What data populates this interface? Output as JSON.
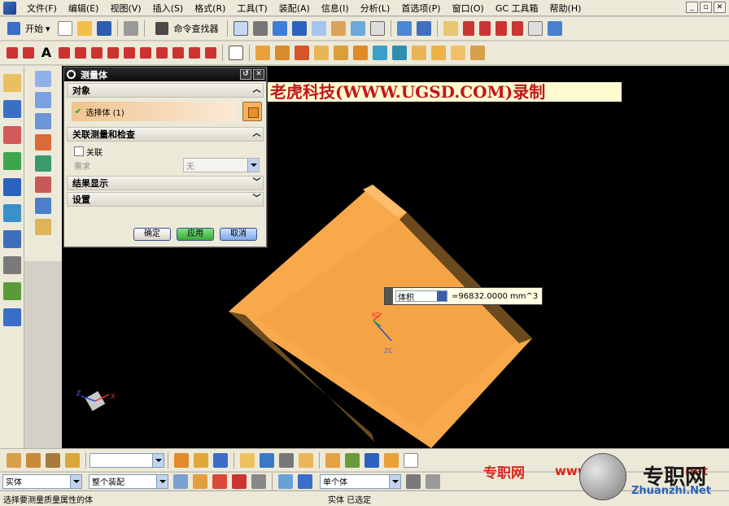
{
  "menubar": {
    "items": [
      "文件(F)",
      "编辑(E)",
      "视图(V)",
      "插入(S)",
      "格式(R)",
      "工具(T)",
      "装配(A)",
      "信息(I)",
      "分析(L)",
      "首选项(P)",
      "窗口(O)",
      "GC 工具箱",
      "帮助(H)"
    ]
  },
  "toolbar1": {
    "start_label": "开始",
    "command_finder_label": "命令查找器"
  },
  "banner": {
    "text": "老虎科技(WWW.UGSD.COM)录制"
  },
  "dialog": {
    "title": "测量体",
    "section_object": "对象",
    "select_body_label": "选择体 (1)",
    "section_assoc": "关联测量和检查",
    "assoc_label": "关联",
    "requirement_label": "需求",
    "requirement_value": "无",
    "section_results": "结果显示",
    "section_settings": "设置",
    "ok_label": "确定",
    "apply_label": "应用",
    "cancel_label": "取消"
  },
  "measure_tooltip": {
    "type": "体积",
    "value": "=96832.0000 mm^3"
  },
  "wcs": {
    "xc": "XC",
    "yc": "YC",
    "zc": "ZC"
  },
  "filterbar": {
    "type_filter": "实体",
    "scope_filter": "整个装配",
    "body_filter": "单个体"
  },
  "statusbar": {
    "prompt": "选择要测量质量属性的体",
    "status": "实体  已选定"
  },
  "watermark": {
    "zh_site": "专职网",
    "www": "www.",
    "net": "net",
    "zh_big": "专职网",
    "domain": "Zhuanzhi.Net"
  },
  "colors": {
    "body_orange": "#f7a94b",
    "body_dark": "#6b4a1e",
    "viewport_bg": "#000000",
    "banner_text": "#c4151c"
  }
}
